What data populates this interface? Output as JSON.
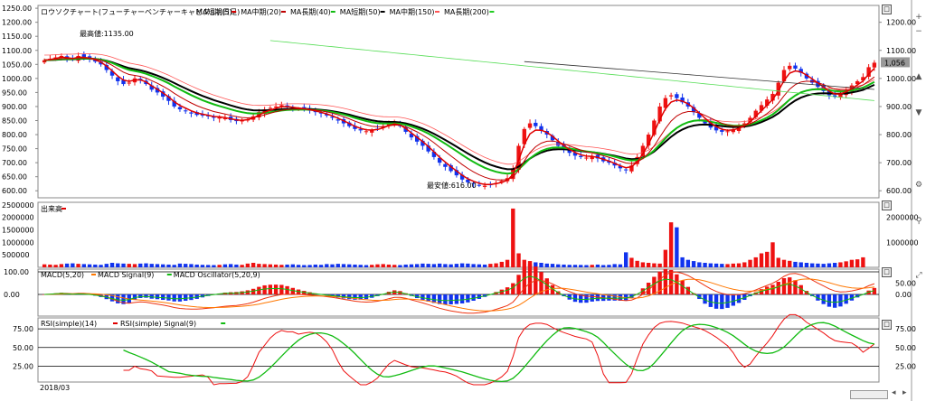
{
  "chart_data": {
    "type": "line",
    "date_label": "2018/03",
    "panels": {
      "price": {
        "title": "ロウソクチャート(フューチャーベンチャーキャピタル)(日足)",
        "legend": [
          {
            "name": "MA短期(5)",
            "color": "#e00000"
          },
          {
            "name": "MA中期(20)",
            "color": "#c00000"
          },
          {
            "name": "MA長期(40)",
            "color": "#11bb11"
          },
          {
            "name": "MA短期(50)",
            "color": "#000000"
          },
          {
            "name": "MA中期(150)",
            "color": "#ff5555"
          },
          {
            "name": "MA長期(200)",
            "color": "#22cc22"
          }
        ],
        "left_ticks": [
          "1250.00",
          "1200.00",
          "1150.00",
          "1100.00",
          "1050.00",
          "1000.00",
          "950.00",
          "900.00",
          "850.00",
          "800.00",
          "750.00",
          "700.00",
          "650.00",
          "600.00"
        ],
        "right_ticks": [
          "1200.00",
          "1100.00",
          "1000.00",
          "900.00",
          "800.00",
          "700.00",
          "600.00"
        ],
        "current_price": "1,056",
        "annotations": {
          "high": "最高値:1135.00",
          "low": "最安値:616.00"
        },
        "ylim": [
          575,
          1260
        ]
      },
      "volume": {
        "title": "出来高",
        "left_ticks": [
          "2500000",
          "2000000",
          "1500000",
          "1000000",
          "500000"
        ],
        "right_ticks": [
          "2000000",
          "1000000"
        ]
      },
      "macd": {
        "title": "MACD(5,20)",
        "legend": [
          {
            "name": "MACD Signal(9)",
            "color": "#ff7700"
          },
          {
            "name": "MACD Oscillator(5,20,9)",
            "color": "#11bb11"
          }
        ],
        "left_ticks": [
          "100.00",
          "0.00"
        ],
        "right_ticks": [
          "50.00",
          "0.00"
        ]
      },
      "rsi": {
        "title": "RSI(simple)(14)",
        "legend": [
          {
            "name": "RSI(simple) Signal(9)",
            "color": "#11bb11"
          }
        ],
        "left_ticks": [
          "75.00",
          "50.00",
          "25.00"
        ],
        "right_ticks": [
          "75.00",
          "50.00",
          "25.00"
        ]
      }
    },
    "closes": [
      1065,
      1070,
      1075,
      1080,
      1072,
      1068,
      1080,
      1075,
      1070,
      1060,
      1050,
      1030,
      1010,
      990,
      980,
      985,
      1000,
      995,
      980,
      960,
      950,
      935,
      920,
      900,
      890,
      885,
      875,
      870,
      868,
      865,
      860,
      862,
      858,
      852,
      848,
      850,
      855,
      865,
      880,
      890,
      895,
      900,
      905,
      900,
      895,
      892,
      890,
      885,
      880,
      875,
      868,
      860,
      850,
      840,
      830,
      820,
      815,
      812,
      815,
      820,
      830,
      840,
      845,
      830,
      810,
      790,
      775,
      760,
      740,
      720,
      700,
      685,
      670,
      655,
      640,
      630,
      625,
      620,
      618,
      622,
      628,
      635,
      645,
      680,
      760,
      820,
      840,
      830,
      815,
      800,
      780,
      760,
      745,
      735,
      725,
      720,
      718,
      722,
      715,
      705,
      700,
      690,
      680,
      675,
      690,
      720,
      760,
      800,
      850,
      900,
      930,
      940,
      930,
      915,
      900,
      880,
      860,
      840,
      825,
      815,
      810,
      812,
      818,
      828,
      840,
      860,
      885,
      905,
      925,
      945,
      985,
      1030,
      1045,
      1035,
      1020,
      1000,
      985,
      970,
      955,
      940,
      935,
      945,
      960,
      975,
      990,
      1005,
      1040,
      1056
    ],
    "volume": [
      120000,
      110000,
      100000,
      130000,
      150000,
      160000,
      140000,
      130000,
      120000,
      110000,
      100000,
      140000,
      180000,
      160000,
      150000,
      140000,
      130000,
      150000,
      160000,
      140000,
      130000,
      120000,
      110000,
      100000,
      150000,
      140000,
      130000,
      110000,
      100000,
      95000,
      90000,
      100000,
      120000,
      130000,
      110000,
      100000,
      150000,
      180000,
      140000,
      130000,
      120000,
      110000,
      100000,
      110000,
      120000,
      100000,
      90000,
      95000,
      110000,
      100000,
      130000,
      120000,
      140000,
      130000,
      120000,
      110000,
      100000,
      90000,
      100000,
      120000,
      130000,
      110000,
      100000,
      90000,
      110000,
      120000,
      130000,
      150000,
      140000,
      130000,
      150000,
      130000,
      120000,
      140000,
      160000,
      150000,
      130000,
      120000,
      110000,
      140000,
      160000,
      220000,
      300000,
      2350000,
      560000,
      300000,
      250000,
      200000,
      180000,
      150000,
      140000,
      120000,
      110000,
      100000,
      100000,
      95000,
      90000,
      100000,
      110000,
      90000,
      100000,
      130000,
      120000,
      600000,
      380000,
      260000,
      200000,
      180000,
      160000,
      150000,
      700000,
      1800000,
      1600000,
      400000,
      300000,
      250000,
      200000,
      180000,
      160000,
      150000,
      140000,
      130000,
      150000,
      160000,
      200000,
      300000,
      400000,
      560000,
      620000,
      1000000,
      380000,
      300000,
      260000,
      220000,
      200000,
      180000,
      160000,
      150000,
      140000,
      160000,
      180000,
      200000,
      240000,
      300000,
      320000,
      400000
    ]
  }
}
